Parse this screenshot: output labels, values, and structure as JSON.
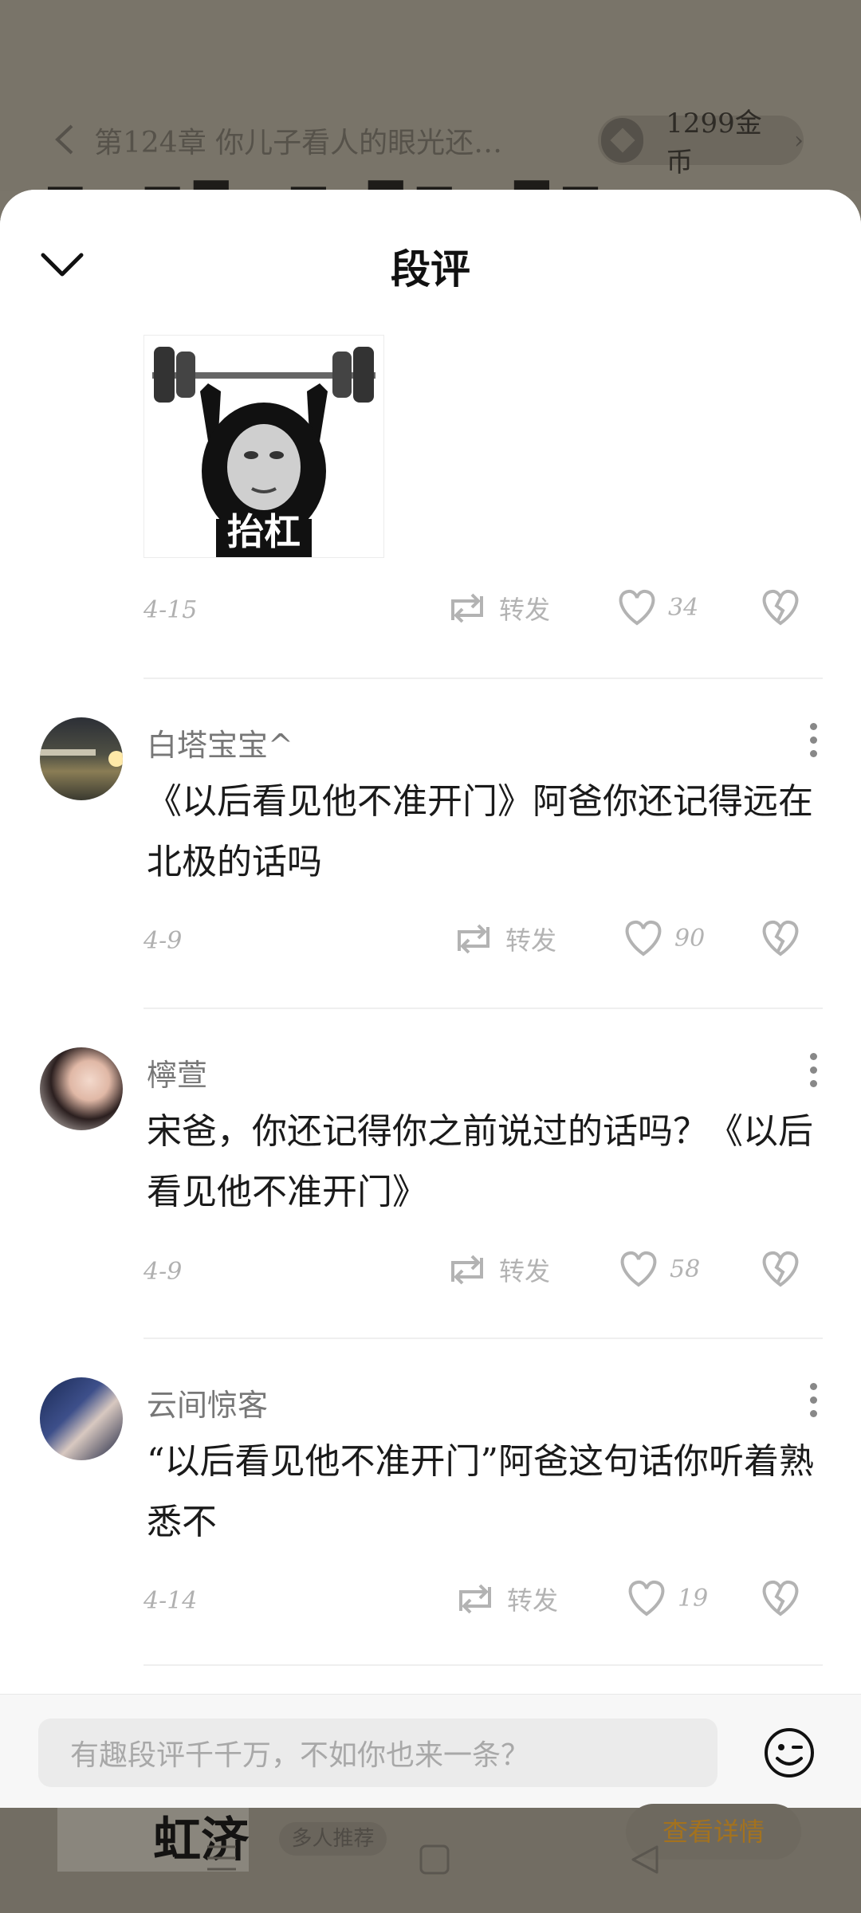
{
  "background": {
    "chapter_title": "第124章 你儿子看人的眼光还…",
    "coins": "1299金币",
    "book_label": "虹济",
    "recommend_tag": "多人推荐",
    "detail_button": "查看详情"
  },
  "sheet": {
    "title": "段评"
  },
  "first_comment": {
    "image_caption": "抬杠",
    "date": "4-15",
    "repost_label": "转发",
    "likes": "34"
  },
  "comments": [
    {
      "username": "白塔宝宝^",
      "text": "《以后看见他不准开门》阿爸你还记得远在北极的话吗",
      "date": "4-9",
      "repost_label": "转发",
      "likes": "90"
    },
    {
      "username": "檸萱",
      "text": "宋爸，你还记得你之前说过的话吗？《以后看见他不准开门》",
      "date": "4-9",
      "repost_label": "转发",
      "likes": "58"
    },
    {
      "username": "云间惊客",
      "text": "“以后看见他不准开门”阿爸这句话你听着熟悉不",
      "date": "4-14",
      "repost_label": "转发",
      "likes": "19"
    }
  ],
  "input": {
    "placeholder": "有趣段评千千万，不如你也来一条？"
  },
  "icons": [
    "back-icon",
    "coin-icon",
    "chevron-down-icon",
    "repost-icon",
    "heart-icon",
    "broken-heart-icon",
    "more-icon",
    "emoji-icon",
    "menu-nav-icon",
    "home-nav-icon",
    "back-nav-icon"
  ],
  "colors": {
    "sheet_bg": "#ffffff",
    "dim_bg": "#7a756a",
    "meta_gray": "#b3b3b3",
    "detail_orange": "#a3721f"
  }
}
